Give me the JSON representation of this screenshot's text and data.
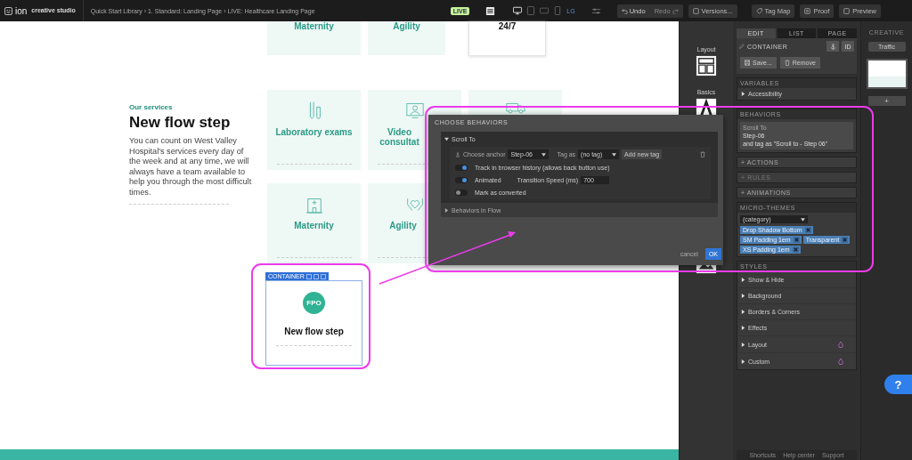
{
  "top_bar": {
    "logo": "ion",
    "product": "creative studio",
    "breadcrumb": "Quick Start Library › 1. Standard: Landing Page › LIVE: Healthcare Landing Page",
    "live_badge": "LIVE",
    "devices": [
      {
        "kind": "desktop",
        "selected": true
      },
      {
        "kind": "tablet",
        "selected": false
      },
      {
        "kind": "landscape",
        "selected": false
      },
      {
        "kind": "phone",
        "selected": false
      },
      {
        "kind": "label",
        "label": "LG",
        "selected": false
      }
    ],
    "history": [
      {
        "kind": "undo",
        "label": "Undo",
        "disabled": false
      },
      {
        "kind": "redo",
        "label": "Redo",
        "disabled": true
      }
    ],
    "buttons": [
      {
        "kind": "versions",
        "label": "Versions..."
      },
      {
        "kind": "tag",
        "label": "Tag Map"
      },
      {
        "kind": "proof",
        "label": "Proof"
      },
      {
        "kind": "preview",
        "label": "Preview"
      }
    ]
  },
  "canvas": {
    "top_cards": [
      {
        "label": "Maternity",
        "kind": "tinted"
      },
      {
        "label": "Agility",
        "kind": "tinted"
      },
      {
        "label": "24/7",
        "kind": "plain"
      }
    ],
    "section": {
      "eyebrow": "Our services",
      "title": "New flow step",
      "body": "You can count on West Valley Hospital's services every day of the week and at any time, we will always have a team available to help you through the most difficult times."
    },
    "service_cards": [
      {
        "label": "Laboratory exams"
      },
      {
        "label": "Video consultat"
      },
      {
        "label": "Maternity"
      },
      {
        "label": "Agility"
      }
    ],
    "selected_card": {
      "toolbar": "CONTAINER",
      "badge": "FPO",
      "title": "New flow step"
    }
  },
  "widgets": [
    {
      "label": "Layout"
    },
    {
      "label": "Basics"
    }
  ],
  "modal": {
    "title": "CHOOSE BEHAVIORS",
    "behavior": {
      "name": "Scroll To",
      "expanded": true,
      "anchor_label": "Choose anchor",
      "anchor_value": "Step-06",
      "tag_label": "Tag as",
      "tag_value": "(no tag)",
      "add_tag": "Add new tag",
      "toggles": [
        {
          "label": "Track in browser history (allows back button use)",
          "on": true
        },
        {
          "label": "Animated",
          "on": true,
          "field": {
            "label": "Transition Speed (ms)",
            "value": "700"
          }
        },
        {
          "label": "Mark as converted",
          "on": false
        }
      ]
    },
    "flow": {
      "label": "Behaviors in Flow",
      "expanded": false
    },
    "cancel": "cancel",
    "ok": "OK"
  },
  "panel": {
    "tabs": [
      {
        "label": "EDIT",
        "selected": true
      },
      {
        "label": "LIST",
        "selected": false
      },
      {
        "label": "PAGE",
        "selected": false
      }
    ],
    "element": "CONTAINER",
    "id_button": "ID",
    "actions": [
      {
        "kind": "save",
        "label": "Save..."
      },
      {
        "kind": "remove",
        "label": "Remove"
      }
    ],
    "variables": {
      "heading": "VARIABLES",
      "items": [
        "Accessibility"
      ]
    },
    "behaviors": {
      "heading": "BEHAVIORS",
      "summary": [
        "Scroll To",
        "Step-06",
        "and tag as \"Scroll to - Step 06\""
      ]
    },
    "collapsibles": [
      {
        "label": "+ ACTIONS",
        "disabled": false
      },
      {
        "label": "+ RULES",
        "disabled": true
      },
      {
        "label": "+ ANIMATIONS",
        "disabled": false
      }
    ],
    "micro_themes": {
      "heading": "MICRO-THEMES",
      "select": "(category)",
      "tags": [
        "Drop Shadow Bottom",
        "SM Padding 1em",
        "Transparent",
        "XS Padding 1em"
      ]
    },
    "styles": {
      "heading": "STYLES",
      "items": [
        {
          "label": "Show & Hide",
          "flagged": false
        },
        {
          "label": "Background",
          "flagged": false
        },
        {
          "label": "Borders & Corners",
          "flagged": false
        },
        {
          "label": "Effects",
          "flagged": false
        },
        {
          "label": "Layout",
          "flagged": true
        },
        {
          "label": "Custom",
          "flagged": true
        }
      ]
    },
    "footer": [
      "Shortcuts",
      "Help center",
      "Support"
    ]
  },
  "creative": {
    "tab": "CREATIVE",
    "traffic": "Traffic",
    "add": "+"
  },
  "help": "?"
}
